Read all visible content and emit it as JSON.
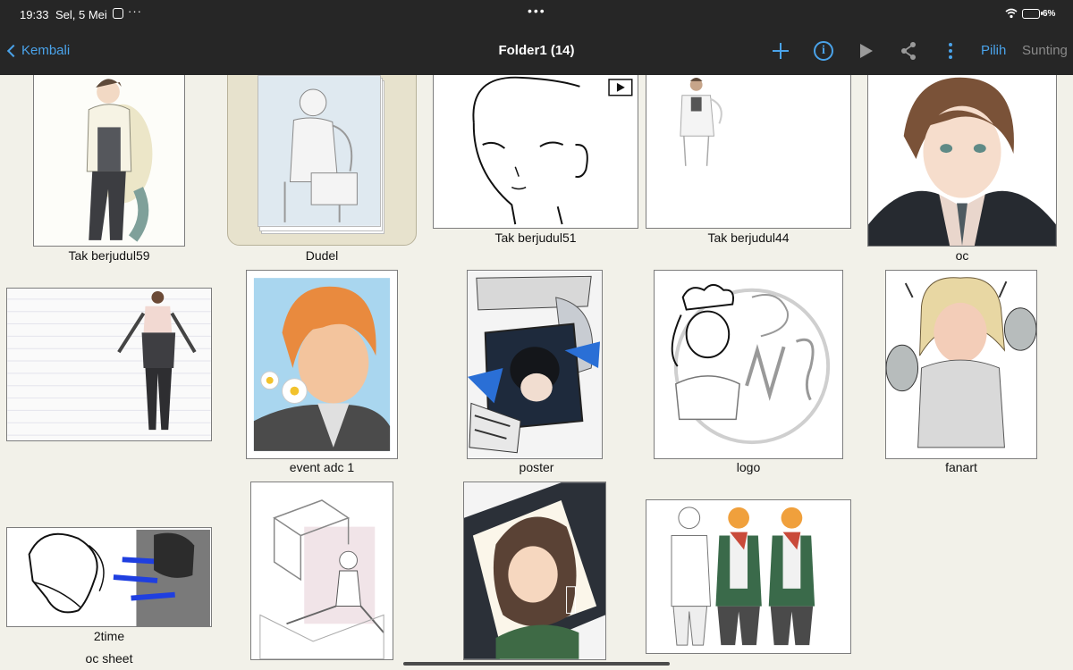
{
  "status_bar": {
    "time": "19:33",
    "date": "Sel, 5 Mei",
    "more": "···",
    "center_dots": "•••",
    "battery_level": "6%"
  },
  "nav": {
    "back_label": "Kembali",
    "title": "Folder1 (14)",
    "info_glyph": "i",
    "select_label": "Pilih",
    "edit_label": "Sunting",
    "icons": [
      "plus-icon",
      "info-icon",
      "play-icon",
      "share-icon",
      "more-vertical-icon"
    ]
  },
  "gallery": {
    "items": [
      {
        "label": "Tak berjudul59"
      },
      {
        "label": "Dudel"
      },
      {
        "label": "Tak berjudul51"
      },
      {
        "label": "Tak berjudul44"
      },
      {
        "label": "oc"
      },
      {
        "label": "oc sheet"
      },
      {
        "label": "event adc 1"
      },
      {
        "label": "poster"
      },
      {
        "label": "logo"
      },
      {
        "label": "fanart"
      },
      {
        "label": "2time"
      },
      {
        "label": ""
      },
      {
        "label": ""
      },
      {
        "label": ""
      }
    ]
  },
  "colors": {
    "accent": "#4aa3ea",
    "bar_background": "#262626",
    "page_background": "#f2f1e9",
    "disabled": "#8a8a8a"
  }
}
